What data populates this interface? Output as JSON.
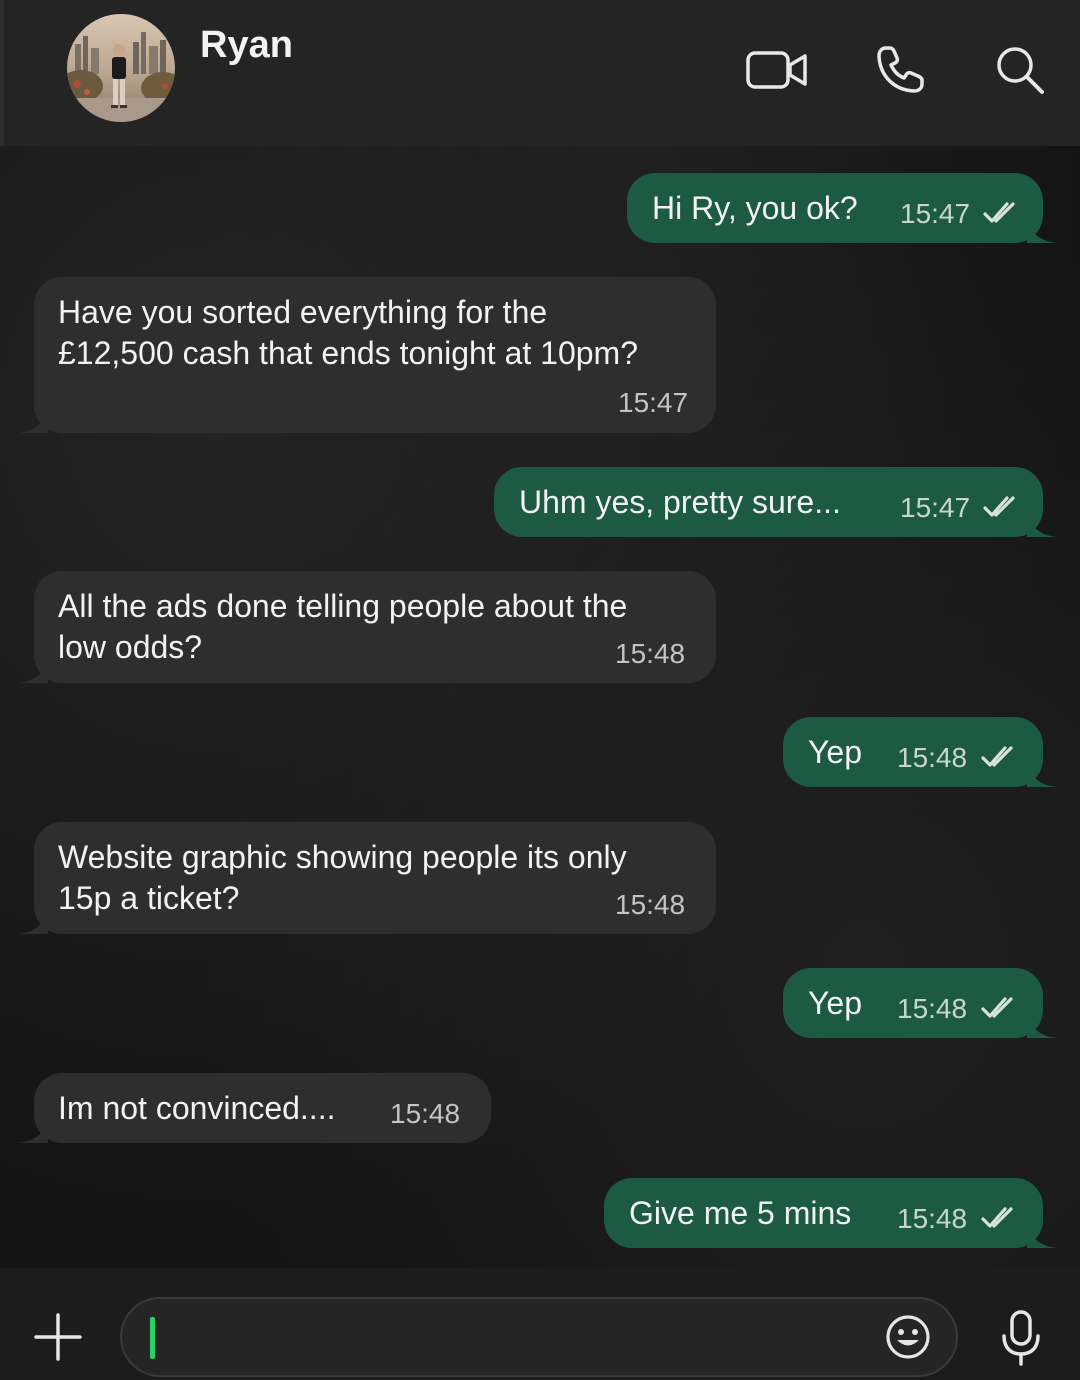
{
  "header": {
    "contact_name": "Ryan"
  },
  "messages": [
    {
      "direction": "out",
      "text": "Hi Ry, you ok?",
      "time": "15:47",
      "status": "read"
    },
    {
      "direction": "in",
      "lines": [
        "Have you sorted everything for the",
        "£12,500 cash that ends tonight at 10pm?"
      ],
      "time": "15:47"
    },
    {
      "direction": "out",
      "text": "Uhm yes, pretty sure...",
      "time": "15:47",
      "status": "read"
    },
    {
      "direction": "in",
      "lines": [
        "All the ads done telling people about the",
        "low odds?"
      ],
      "time": "15:48"
    },
    {
      "direction": "out",
      "text": "Yep",
      "time": "15:48",
      "status": "read"
    },
    {
      "direction": "in",
      "lines": [
        "Website graphic showing people its only",
        "15p a ticket?"
      ],
      "time": "15:48"
    },
    {
      "direction": "out",
      "text": "Yep",
      "time": "15:48",
      "status": "read"
    },
    {
      "direction": "in",
      "text": "Im not convinced....",
      "time": "15:48"
    },
    {
      "direction": "out",
      "text": "Give me 5 mins",
      "time": "15:48",
      "status": "read"
    }
  ],
  "composer": {
    "value": ""
  },
  "colors": {
    "outgoing_bubble": "#1d5a43",
    "incoming_bubble": "#2e2e2e",
    "header_bg": "#242424",
    "caret": "#25d366"
  },
  "icons": {
    "header": [
      "video-call-icon",
      "voice-call-icon",
      "search-icon"
    ],
    "footer": [
      "attach-plus-icon",
      "emoji-icon",
      "microphone-icon"
    ]
  }
}
